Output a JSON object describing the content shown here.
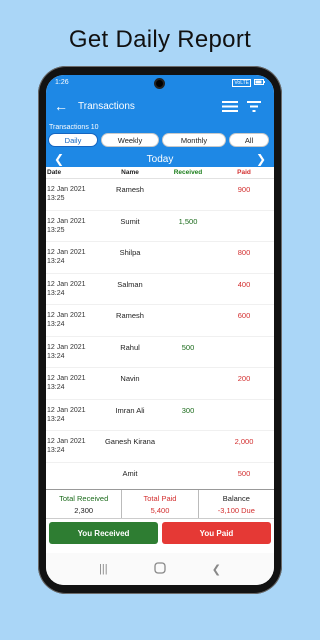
{
  "headline": "Get Daily Report",
  "status": {
    "time": "1:26",
    "network": "VoLTE"
  },
  "appbar": {
    "title": "Transactions"
  },
  "transactions_count": "Transactions 10",
  "tabs": [
    {
      "label": "Daily",
      "active": true
    },
    {
      "label": "Weekly",
      "active": false
    },
    {
      "label": "Monthly",
      "active": false
    },
    {
      "label": "All",
      "active": false
    }
  ],
  "day": {
    "label": "Today"
  },
  "columns": {
    "date": "Date",
    "name": "Name",
    "received": "Received",
    "paid": "Paid"
  },
  "rows": [
    {
      "date": "12 Jan 2021",
      "time": "13:25",
      "name": "Ramesh",
      "received": "",
      "paid": "900"
    },
    {
      "date": "12 Jan 2021",
      "time": "13:25",
      "name": "Sumit",
      "received": "1,500",
      "paid": ""
    },
    {
      "date": "12 Jan 2021",
      "time": "13:24",
      "name": "Shilpa",
      "received": "",
      "paid": "800"
    },
    {
      "date": "12 Jan 2021",
      "time": "13:24",
      "name": "Salman",
      "received": "",
      "paid": "400"
    },
    {
      "date": "12 Jan 2021",
      "time": "13:24",
      "name": "Ramesh",
      "received": "",
      "paid": "600"
    },
    {
      "date": "12 Jan 2021",
      "time": "13:24",
      "name": "Rahul",
      "received": "500",
      "paid": ""
    },
    {
      "date": "12 Jan 2021",
      "time": "13:24",
      "name": "Navin",
      "received": "",
      "paid": "200"
    },
    {
      "date": "12 Jan 2021",
      "time": "13:24",
      "name": "Imran Ali",
      "received": "300",
      "paid": ""
    },
    {
      "date": "12 Jan 2021",
      "time": "13:24",
      "name": "Ganesh Kirana",
      "received": "",
      "paid": "2,000"
    },
    {
      "date": "",
      "time": "",
      "name": "Amit",
      "received": "",
      "paid": "500"
    }
  ],
  "summary": {
    "total_received_label": "Total Received",
    "total_received": "2,300",
    "total_paid_label": "Total Paid",
    "total_paid": "5,400",
    "balance_label": "Balance",
    "balance": "-3,100 Due"
  },
  "actions": {
    "received": "You Received",
    "paid": "You Paid"
  },
  "colors": {
    "brand": "#1e88e5",
    "received": "#2e7d32",
    "paid": "#e53935",
    "background": "#aad6f7"
  }
}
